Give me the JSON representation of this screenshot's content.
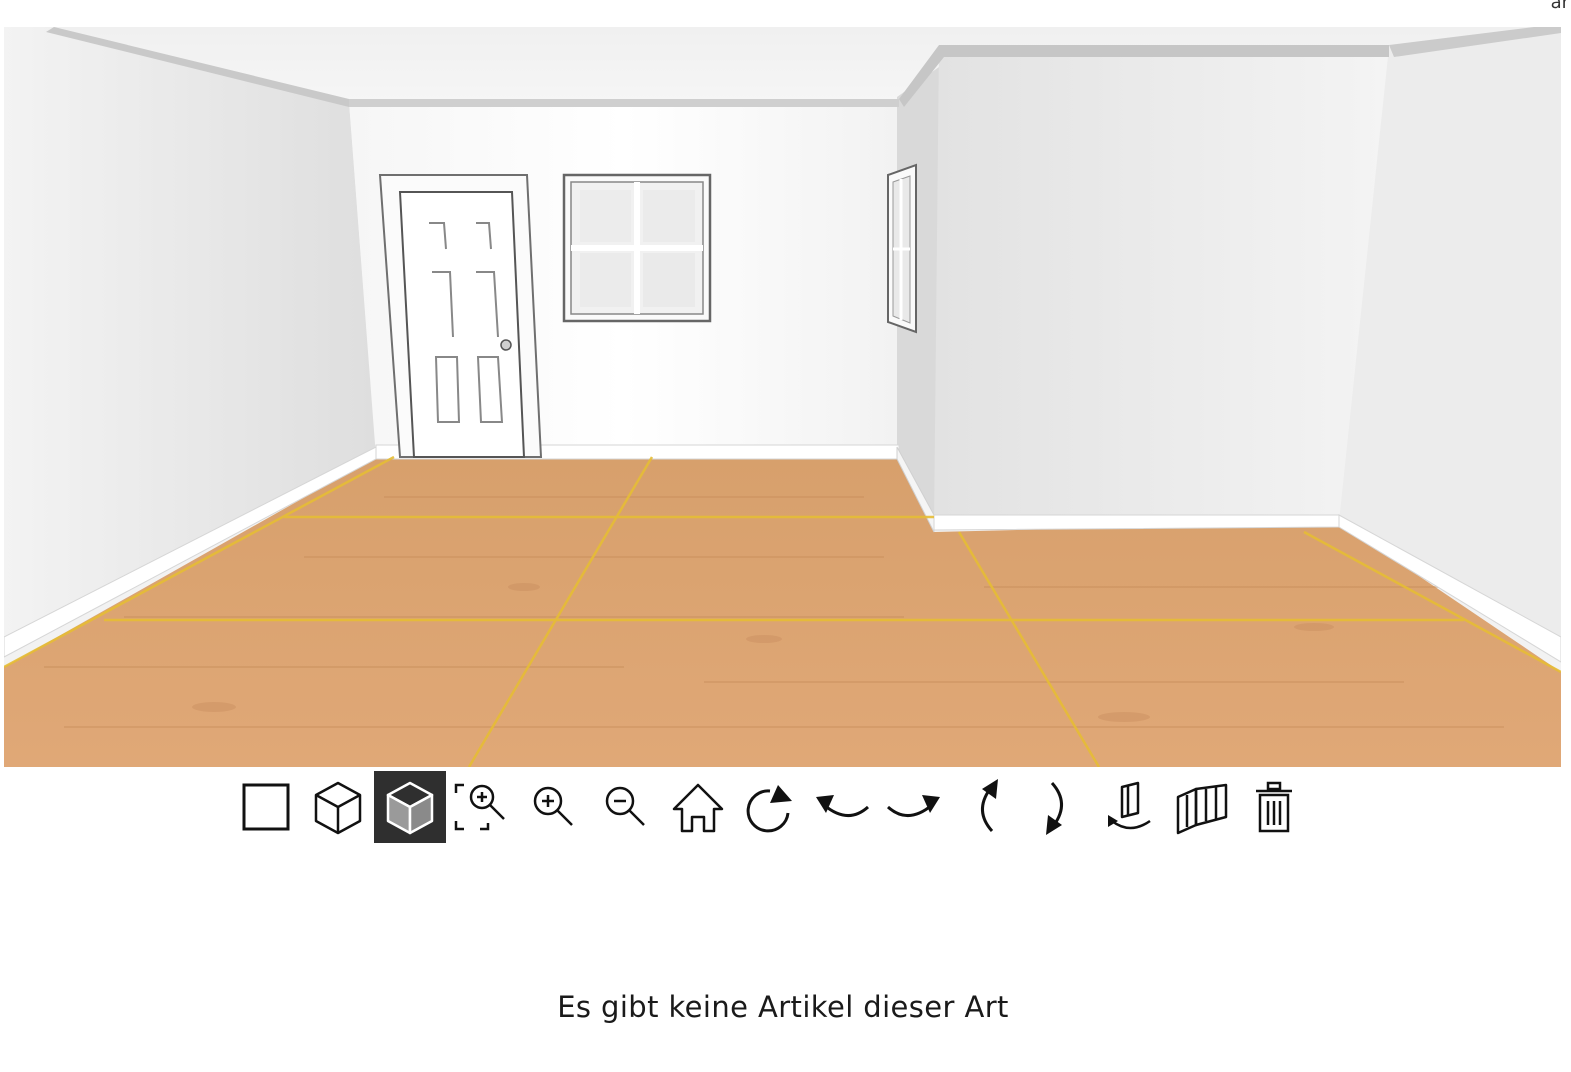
{
  "corner_label": "ar",
  "scene": {
    "floor_color": "#d9a06a",
    "grid_color": "#e8c23a"
  },
  "toolbar": {
    "active_tool": "view-3d-shaded",
    "tools": [
      {
        "id": "view-2d",
        "icon": "square-icon"
      },
      {
        "id": "view-3d",
        "icon": "cube-outline-icon"
      },
      {
        "id": "view-3d-shaded",
        "icon": "cube-shaded-icon"
      },
      {
        "id": "zoom-fit",
        "icon": "zoom-to-fit-icon"
      },
      {
        "id": "zoom-in",
        "icon": "zoom-in-icon"
      },
      {
        "id": "zoom-out",
        "icon": "zoom-out-icon"
      },
      {
        "id": "home",
        "icon": "home-icon"
      },
      {
        "id": "reset-view",
        "icon": "rotate-reset-icon"
      },
      {
        "id": "rotate-left",
        "icon": "rotate-left-icon"
      },
      {
        "id": "rotate-right",
        "icon": "rotate-right-icon"
      },
      {
        "id": "tilt-up",
        "icon": "tilt-up-icon"
      },
      {
        "id": "tilt-down",
        "icon": "tilt-down-icon"
      },
      {
        "id": "rotate-object",
        "icon": "rotate-object-icon"
      },
      {
        "id": "walls-view",
        "icon": "walls-icon"
      },
      {
        "id": "delete",
        "icon": "trash-icon"
      }
    ]
  },
  "empty_message": "Es gibt keine Artikel dieser Art"
}
